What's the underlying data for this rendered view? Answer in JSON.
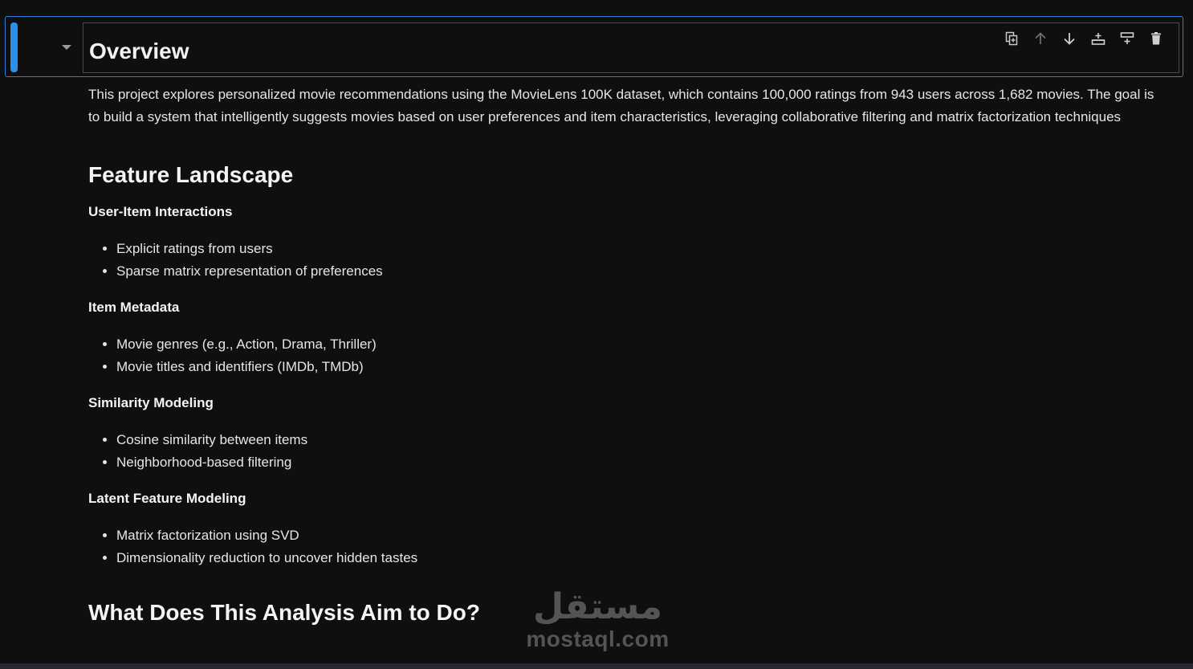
{
  "cell": {
    "title": "Overview"
  },
  "toolbar": [
    {
      "name": "duplicate-cell-icon",
      "label": "Duplicate"
    },
    {
      "name": "move-up-icon",
      "label": "Move up"
    },
    {
      "name": "move-down-icon",
      "label": "Move down"
    },
    {
      "name": "insert-below-icon",
      "label": "Insert below"
    },
    {
      "name": "insert-above-icon",
      "label": "Insert above"
    },
    {
      "name": "delete-icon",
      "label": "Delete"
    }
  ],
  "markdown": {
    "intro": "This project explores personalized movie recommendations using the MovieLens 100K dataset, which contains 100,000 ratings from 943 users across 1,682 movies. The goal is to build a system that intelligently suggests movies based on user preferences and item characteristics, leveraging collaborative filtering and matrix factorization techniques",
    "feature_heading": "Feature Landscape",
    "groups": [
      {
        "title": "User-Item Interactions",
        "items": [
          "Explicit ratings from users",
          "Sparse matrix representation of preferences"
        ]
      },
      {
        "title": "Item Metadata",
        "items": [
          "Movie genres (e.g., Action, Drama, Thriller)",
          "Movie titles and identifiers (IMDb, TMDb)"
        ]
      },
      {
        "title": "Similarity Modeling",
        "items": [
          "Cosine similarity between items",
          "Neighborhood-based filtering"
        ]
      },
      {
        "title": "Latent Feature Modeling",
        "items": [
          "Matrix factorization using SVD",
          "Dimensionality reduction to uncover hidden tastes"
        ]
      }
    ],
    "aim_heading": "What Does This Analysis Aim to Do?"
  },
  "watermark": {
    "arabic": "مستقل",
    "latin": "mostaql.com"
  },
  "colors": {
    "accent": "#2b8fee",
    "background": "#0f0f10",
    "text": "#e6e6e6"
  }
}
